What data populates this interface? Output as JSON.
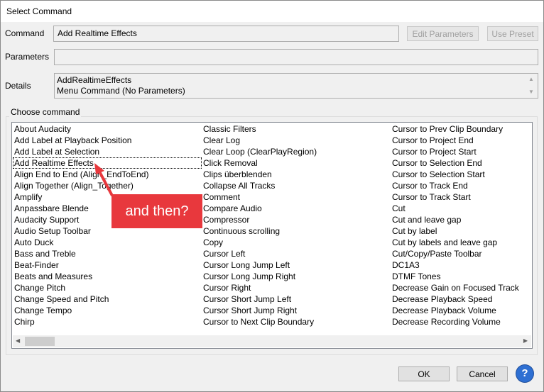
{
  "window": {
    "title": "Select Command"
  },
  "command": {
    "label": "Command",
    "value": "Add Realtime Effects",
    "edit_button": "Edit Parameters",
    "preset_button": "Use Preset"
  },
  "parameters": {
    "label": "Parameters",
    "value": ""
  },
  "details": {
    "label": "Details",
    "line1": "AddRealtimeEffects",
    "line2": "Menu Command (No Parameters)"
  },
  "choose": {
    "title": "Choose command",
    "col1": [
      "About Audacity",
      "Add Label at Playback Position",
      "Add Label at Selection",
      "Add Realtime Effects",
      "Align End to End (Align_EndToEnd)",
      "Align Together (Align_Together)",
      "Amplify",
      "Anpassbare Blende",
      "Audacity Support",
      "Audio Setup Toolbar",
      "Auto Duck",
      "Bass and Treble",
      "Beat-Finder",
      "Beats and Measures",
      "Change Pitch",
      "Change Speed and Pitch",
      "Change Tempo",
      "Chirp"
    ],
    "col2": [
      "Classic Filters",
      "Clear Log",
      "Clear Loop (ClearPlayRegion)",
      "Click Removal",
      "Clips überblenden",
      "Collapse All Tracks",
      "Comment",
      "Compare Audio",
      "Compressor",
      "Continuous scrolling",
      "Copy",
      "Cursor Left",
      "Cursor Long Jump Left",
      "Cursor Long Jump Right",
      "Cursor Right",
      "Cursor Short Jump Left",
      "Cursor Short Jump Right",
      "Cursor to Next Clip Boundary"
    ],
    "col3": [
      "Cursor to Prev Clip Boundary",
      "Cursor to Project End",
      "Cursor to Project Start",
      "Cursor to Selection End",
      "Cursor to Selection Start",
      "Cursor to Track End",
      "Cursor to Track Start",
      "Cut",
      "Cut and leave gap",
      "Cut by label",
      "Cut by labels and leave gap",
      "Cut/Copy/Paste Toolbar",
      "DC1A3",
      "DTMF Tones",
      "Decrease Gain on Focused Track",
      "Decrease Playback Speed",
      "Decrease Playback Volume",
      "Decrease Recording Volume"
    ],
    "selected_index": 3
  },
  "annotation": {
    "text": "and then?",
    "color": "#e8383d"
  },
  "buttons": {
    "ok": "OK",
    "cancel": "Cancel",
    "help": "?"
  },
  "colors": {
    "help_blue": "#2e6fd2",
    "callout_red": "#e8383d"
  }
}
